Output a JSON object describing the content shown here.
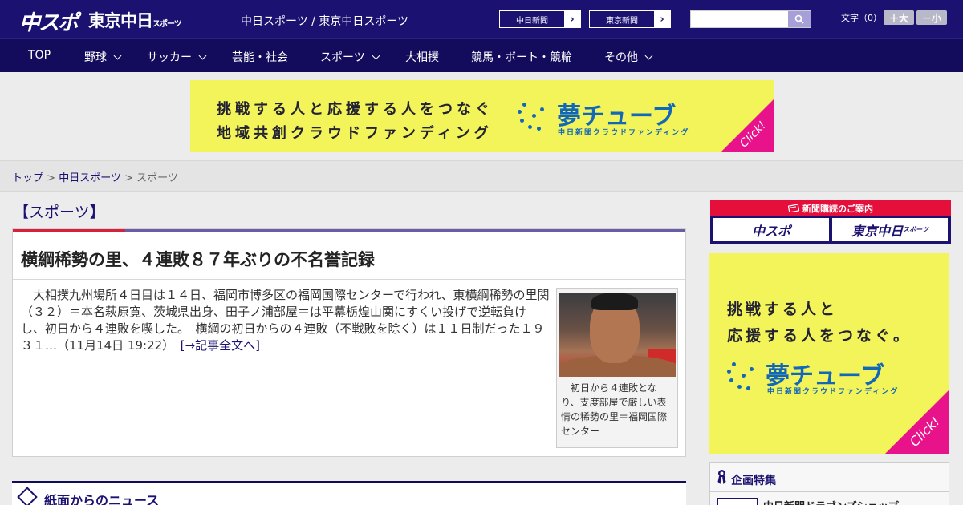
{
  "header": {
    "logo_chuspo": "中スポ",
    "logo_tokyo": "東京中日",
    "logo_tokyo_small": "スポーツ",
    "site_title": "中日スポーツ / 東京中日スポーツ",
    "paper_links": [
      {
        "label": "中日新聞",
        "arrow": "›"
      },
      {
        "label": "東京新聞",
        "arrow": "›"
      }
    ],
    "search": {
      "placeholder": "",
      "icon": "search-icon"
    },
    "font_size": {
      "label": "文字（0）",
      "increase": "＋大",
      "decrease": "－小"
    }
  },
  "nav": {
    "items": [
      {
        "label": "TOP",
        "dropdown": false
      },
      {
        "label": "野球",
        "dropdown": true
      },
      {
        "label": "サッカー",
        "dropdown": true
      },
      {
        "label": "芸能・社会",
        "dropdown": false
      },
      {
        "label": "スポーツ",
        "dropdown": true
      },
      {
        "label": "大相撲",
        "dropdown": false
      },
      {
        "label": "競馬・ボート・競輪",
        "dropdown": false
      },
      {
        "label": "その他",
        "dropdown": true
      }
    ]
  },
  "ad_top": {
    "line1": "挑戦する人と応援する人をつなぐ",
    "line2": "地域共創クラウドファンディング",
    "logo": "夢チューブ",
    "logo_sub": "中日新聞クラウドファンディング",
    "click": "Click!",
    "bg_color": "#f3f35a",
    "accent_color": "#e8128b"
  },
  "breadcrumb": {
    "items": [
      "トップ",
      "中日スポーツ",
      "スポーツ"
    ],
    "separator": ">"
  },
  "main": {
    "section_heading": "【スポーツ】",
    "article": {
      "title": "横綱稀勢の里、４連敗８７年ぶりの不名誉記録",
      "body": "　大相撲九州場所４日目は１４日、福岡市博多区の福岡国際センターで行われ、東横綱稀勢の里関（３２）＝本名萩原寛、茨城県出身、田子ノ浦部屋＝は平幕栃煌山関にすくい投げで逆転負けし、初日から４連敗を喫した。　横綱の初日からの４連敗（不戦敗を除く）は１１日制だった１９３１…（11月14日 19:22）　",
      "more_link": "[→記事全文へ]",
      "photo_caption": "初日から４連敗となり、支度部屋で厳しい表情の稀勢の里＝福岡国際センター"
    },
    "news_section_title": "紙面からのニュース"
  },
  "sidebar": {
    "subscribe_header": "新聞購読のご案内",
    "subscribe_buttons": [
      "中スポ",
      "東京中日"
    ],
    "subscribe_small": "スポーツ",
    "ad_side": {
      "line1": "挑戦する人と",
      "line2": "応援する人をつなぐ。",
      "logo": "夢チューブ",
      "logo_sub": "中日新聞クラウドファンディング",
      "click": "Click!"
    },
    "feature": {
      "title": "企画特集",
      "item": "中日新聞ドラゴンズショップ"
    }
  },
  "colors": {
    "brand_navy": "#1a1170",
    "nav_navy": "#130b5c",
    "accent_red": "#d6213a",
    "accent_purple": "#6c5ca8"
  }
}
